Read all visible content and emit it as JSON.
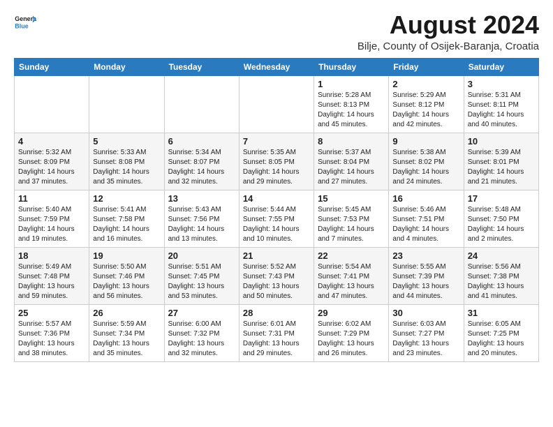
{
  "logo": {
    "text_general": "General",
    "text_blue": "Blue"
  },
  "header": {
    "month": "August 2024",
    "location": "Bilje, County of Osijek-Baranja, Croatia"
  },
  "days_of_week": [
    "Sunday",
    "Monday",
    "Tuesday",
    "Wednesday",
    "Thursday",
    "Friday",
    "Saturday"
  ],
  "weeks": [
    [
      {
        "day": "",
        "info": ""
      },
      {
        "day": "",
        "info": ""
      },
      {
        "day": "",
        "info": ""
      },
      {
        "day": "",
        "info": ""
      },
      {
        "day": "1",
        "info": "Sunrise: 5:28 AM\nSunset: 8:13 PM\nDaylight: 14 hours\nand 45 minutes."
      },
      {
        "day": "2",
        "info": "Sunrise: 5:29 AM\nSunset: 8:12 PM\nDaylight: 14 hours\nand 42 minutes."
      },
      {
        "day": "3",
        "info": "Sunrise: 5:31 AM\nSunset: 8:11 PM\nDaylight: 14 hours\nand 40 minutes."
      }
    ],
    [
      {
        "day": "4",
        "info": "Sunrise: 5:32 AM\nSunset: 8:09 PM\nDaylight: 14 hours\nand 37 minutes."
      },
      {
        "day": "5",
        "info": "Sunrise: 5:33 AM\nSunset: 8:08 PM\nDaylight: 14 hours\nand 35 minutes."
      },
      {
        "day": "6",
        "info": "Sunrise: 5:34 AM\nSunset: 8:07 PM\nDaylight: 14 hours\nand 32 minutes."
      },
      {
        "day": "7",
        "info": "Sunrise: 5:35 AM\nSunset: 8:05 PM\nDaylight: 14 hours\nand 29 minutes."
      },
      {
        "day": "8",
        "info": "Sunrise: 5:37 AM\nSunset: 8:04 PM\nDaylight: 14 hours\nand 27 minutes."
      },
      {
        "day": "9",
        "info": "Sunrise: 5:38 AM\nSunset: 8:02 PM\nDaylight: 14 hours\nand 24 minutes."
      },
      {
        "day": "10",
        "info": "Sunrise: 5:39 AM\nSunset: 8:01 PM\nDaylight: 14 hours\nand 21 minutes."
      }
    ],
    [
      {
        "day": "11",
        "info": "Sunrise: 5:40 AM\nSunset: 7:59 PM\nDaylight: 14 hours\nand 19 minutes."
      },
      {
        "day": "12",
        "info": "Sunrise: 5:41 AM\nSunset: 7:58 PM\nDaylight: 14 hours\nand 16 minutes."
      },
      {
        "day": "13",
        "info": "Sunrise: 5:43 AM\nSunset: 7:56 PM\nDaylight: 14 hours\nand 13 minutes."
      },
      {
        "day": "14",
        "info": "Sunrise: 5:44 AM\nSunset: 7:55 PM\nDaylight: 14 hours\nand 10 minutes."
      },
      {
        "day": "15",
        "info": "Sunrise: 5:45 AM\nSunset: 7:53 PM\nDaylight: 14 hours\nand 7 minutes."
      },
      {
        "day": "16",
        "info": "Sunrise: 5:46 AM\nSunset: 7:51 PM\nDaylight: 14 hours\nand 4 minutes."
      },
      {
        "day": "17",
        "info": "Sunrise: 5:48 AM\nSunset: 7:50 PM\nDaylight: 14 hours\nand 2 minutes."
      }
    ],
    [
      {
        "day": "18",
        "info": "Sunrise: 5:49 AM\nSunset: 7:48 PM\nDaylight: 13 hours\nand 59 minutes."
      },
      {
        "day": "19",
        "info": "Sunrise: 5:50 AM\nSunset: 7:46 PM\nDaylight: 13 hours\nand 56 minutes."
      },
      {
        "day": "20",
        "info": "Sunrise: 5:51 AM\nSunset: 7:45 PM\nDaylight: 13 hours\nand 53 minutes."
      },
      {
        "day": "21",
        "info": "Sunrise: 5:52 AM\nSunset: 7:43 PM\nDaylight: 13 hours\nand 50 minutes."
      },
      {
        "day": "22",
        "info": "Sunrise: 5:54 AM\nSunset: 7:41 PM\nDaylight: 13 hours\nand 47 minutes."
      },
      {
        "day": "23",
        "info": "Sunrise: 5:55 AM\nSunset: 7:39 PM\nDaylight: 13 hours\nand 44 minutes."
      },
      {
        "day": "24",
        "info": "Sunrise: 5:56 AM\nSunset: 7:38 PM\nDaylight: 13 hours\nand 41 minutes."
      }
    ],
    [
      {
        "day": "25",
        "info": "Sunrise: 5:57 AM\nSunset: 7:36 PM\nDaylight: 13 hours\nand 38 minutes."
      },
      {
        "day": "26",
        "info": "Sunrise: 5:59 AM\nSunset: 7:34 PM\nDaylight: 13 hours\nand 35 minutes."
      },
      {
        "day": "27",
        "info": "Sunrise: 6:00 AM\nSunset: 7:32 PM\nDaylight: 13 hours\nand 32 minutes."
      },
      {
        "day": "28",
        "info": "Sunrise: 6:01 AM\nSunset: 7:31 PM\nDaylight: 13 hours\nand 29 minutes."
      },
      {
        "day": "29",
        "info": "Sunrise: 6:02 AM\nSunset: 7:29 PM\nDaylight: 13 hours\nand 26 minutes."
      },
      {
        "day": "30",
        "info": "Sunrise: 6:03 AM\nSunset: 7:27 PM\nDaylight: 13 hours\nand 23 minutes."
      },
      {
        "day": "31",
        "info": "Sunrise: 6:05 AM\nSunset: 7:25 PM\nDaylight: 13 hours\nand 20 minutes."
      }
    ]
  ]
}
